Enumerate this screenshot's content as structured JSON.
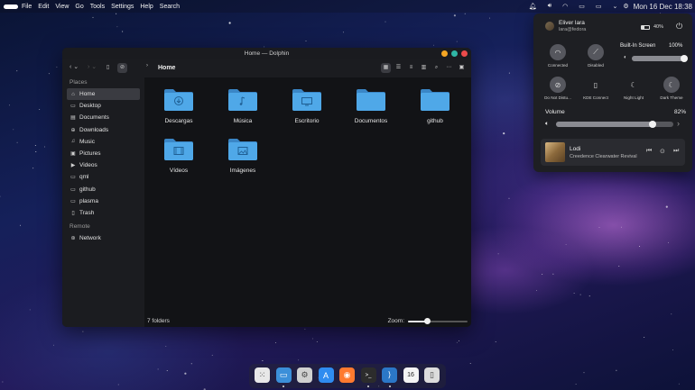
{
  "topbar": {
    "menus": [
      "File",
      "Edit",
      "View",
      "Go",
      "Tools",
      "Settings",
      "Help",
      "Search"
    ],
    "tray_icons": [
      "notification-icon",
      "volume-icon",
      "wifi-icon",
      "screen-icon",
      "battery-icon",
      "chevron-icon",
      "settings-icon"
    ],
    "clock": "Mon 16 Dec 18:38"
  },
  "window": {
    "title": "Home — Dolphin",
    "breadcrumb": "Home",
    "places_title": "Places",
    "places": [
      {
        "label": "Home",
        "icon": "home-icon",
        "selected": true
      },
      {
        "label": "Desktop",
        "icon": "desktop-icon"
      },
      {
        "label": "Documents",
        "icon": "documents-icon"
      },
      {
        "label": "Downloads",
        "icon": "downloads-icon"
      },
      {
        "label": "Music",
        "icon": "music-icon"
      },
      {
        "label": "Pictures",
        "icon": "pictures-icon"
      },
      {
        "label": "Videos",
        "icon": "videos-icon"
      },
      {
        "label": "qml",
        "icon": "folder-icon"
      },
      {
        "label": "github",
        "icon": "folder-icon"
      },
      {
        "label": "plasma",
        "icon": "folder-icon"
      },
      {
        "label": "Trash",
        "icon": "trash-icon"
      }
    ],
    "remote_title": "Remote",
    "remote": [
      {
        "label": "Network",
        "icon": "network-icon"
      }
    ],
    "folders": [
      {
        "name": "Descargas",
        "icon": "download-glyph"
      },
      {
        "name": "Música",
        "icon": "music-glyph"
      },
      {
        "name": "Escritorio",
        "icon": "desktop-glyph"
      },
      {
        "name": "Documentos",
        "icon": "none"
      },
      {
        "name": "github",
        "icon": "none"
      },
      {
        "name": "Vídeos",
        "icon": "video-glyph"
      },
      {
        "name": "Imágenes",
        "icon": "image-glyph"
      }
    ],
    "status": "7 folders",
    "zoom_label": "Zoom:",
    "zoom_level": 0.33,
    "folder_color": "#4fa8e8"
  },
  "panel": {
    "user_name": "Eliver lara",
    "user_email": "lara@fedora",
    "battery": "40%",
    "battery_level": 0.4,
    "tiles": [
      {
        "label": "Connected",
        "icon": "wifi-icon"
      },
      {
        "label": "Disabled",
        "icon": "bluetooth-off-icon"
      },
      {
        "label": "Do Not Distu...",
        "icon": "do-not-disturb-icon"
      },
      {
        "label": "KDE Connect",
        "icon": "kde-connect-icon"
      },
      {
        "label": "Night Light",
        "icon": "night-light-icon"
      },
      {
        "label": "Dark Theme",
        "icon": "dark-theme-icon"
      }
    ],
    "brightness_title": "Built-In Screen",
    "brightness_value": "100%",
    "brightness_level": 1.0,
    "volume_title": "Volume",
    "volume_value": "82%",
    "volume_level": 0.82,
    "media": {
      "title": "Lodi",
      "artist": "Creedence Clearwater Revival"
    }
  },
  "dock": {
    "apps": [
      {
        "name": "app-launcher-icon",
        "color": "#e8e8e8"
      },
      {
        "name": "file-manager-icon",
        "color": "#3b8fd9"
      },
      {
        "name": "settings-app-icon",
        "color": "#d0d0d0"
      },
      {
        "name": "app-store-icon",
        "color": "#2f8cf0"
      },
      {
        "name": "firefox-icon",
        "color": "#ff7a2f"
      },
      {
        "name": "terminal-icon",
        "color": "#2c2c2c"
      },
      {
        "name": "vscode-icon",
        "color": "#2b77c7"
      },
      {
        "name": "calendar-icon",
        "color": "#f4f4f4"
      },
      {
        "name": "trash-app-icon",
        "color": "#dcdcdc"
      }
    ],
    "calendar_day": "16"
  }
}
